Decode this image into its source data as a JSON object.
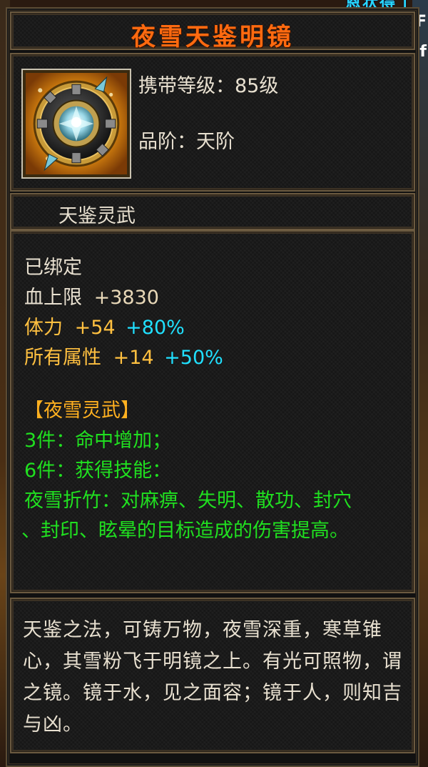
{
  "background": {
    "corner_text": "恩状得丁",
    "side_glyphs": [
      "F",
      "f"
    ]
  },
  "item": {
    "name": "夜雪天鉴明镜",
    "icon": "mirror-disc-icon",
    "carry_level_label": "携带等级：85级",
    "grade_label": "品阶：天阶",
    "type_label": "天鉴灵武"
  },
  "attributes": {
    "bound": "已绑定",
    "hp": {
      "name": "血上限",
      "value": "+3830"
    },
    "stamina": {
      "name": "体力",
      "value": "+54",
      "bonus": "+80%"
    },
    "all_attr": {
      "name": "所有属性",
      "value": "+14",
      "bonus": "+50%"
    }
  },
  "set": {
    "title": "【夜雪灵武】",
    "bonus3": "3件：命中增加；",
    "bonus6": "6件：获得技能：",
    "skill_line1": "夜雪折竹：对麻痹、失明、散功、封穴",
    "skill_line2": "、封印、眩晕的目标造成的伤害提高。"
  },
  "description": "天鉴之法，可铸万物，夜雪深重，寒草锥心，其雪粉飞于明镜之上。有光可照物，谓之镜。镜于水，见之面容；镜于人，则知吉与凶。",
  "colors": {
    "title": "#ff6a10",
    "gold_attr": "#ffc040",
    "bonus_cyan": "#20e0ff",
    "set_green": "#20e020",
    "frame": "#6b5a40"
  }
}
